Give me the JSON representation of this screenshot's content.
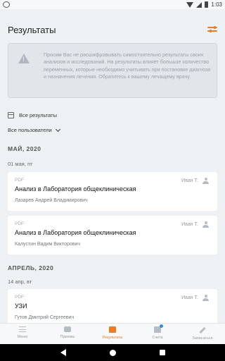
{
  "status_bar": {
    "time": "1:03",
    "icons": [
      "wifi-icon",
      "signal-icon",
      "battery-icon"
    ]
  },
  "app_bar": {
    "title": "Результаты",
    "filter_icon": "sliders-icon"
  },
  "notice": {
    "icon": "warning-icon",
    "text": "Просим Вас не расшифровывать самостоятельно результаты своих анализов и исследований. На результаты влияет большое количество переменных, которые необходимо учитывать при постановке диагноза и назначения лечения. Обратитесь к вашему лечащему врачу."
  },
  "filters": {
    "period": "Все результаты",
    "users": "Все пользователи"
  },
  "groups": [
    {
      "month": "МАЙ, 2020",
      "day": "01 мая, пт",
      "cards": [
        {
          "type": "PDF",
          "title": "Анализ в Лаборатория общеклиническая",
          "doctor": "Лазарев Андрей Владимирович",
          "user": "Иван Т."
        },
        {
          "type": "PDF",
          "title": "Анализ в Лаборатория общеклиническая",
          "doctor": "Калустин Вадим Викторович",
          "user": "Иван Т."
        }
      ]
    },
    {
      "month": "АПРЕЛЬ, 2020",
      "day": "14 апр, вт",
      "cards": [
        {
          "type": "PDF",
          "title": "УЗИ",
          "doctor": "Гутов Дмитрий Сергеевич",
          "user": "Иван Т."
        }
      ]
    }
  ],
  "bottom_nav": [
    {
      "label": "Меню",
      "icon": "menu-icon"
    },
    {
      "label": "Приемы",
      "icon": "sofa-icon"
    },
    {
      "label": "Результаты",
      "icon": "results-icon",
      "active": true
    },
    {
      "label": "Счета",
      "icon": "bills-icon",
      "badge": true
    },
    {
      "label": "Записаться",
      "icon": "pen-icon"
    }
  ],
  "colors": {
    "accent": "#f07c22",
    "background": "#eef1f4",
    "badge": "#2d8cf0"
  }
}
